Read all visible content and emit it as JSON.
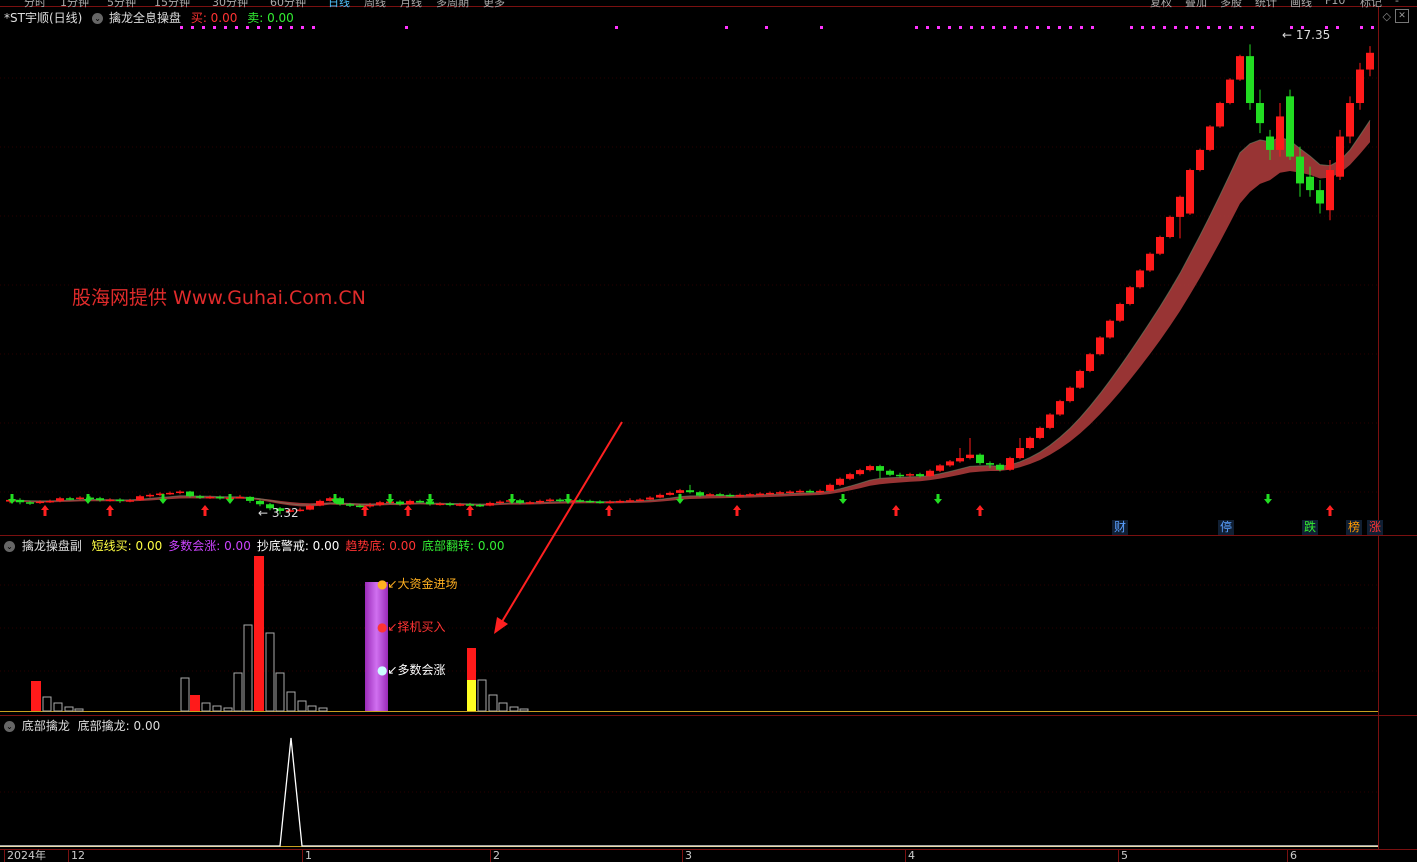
{
  "top_tabs": [
    "分时",
    "1分钟",
    "5分钟",
    "15分钟",
    "30分钟",
    "60分钟",
    "日线",
    "周线",
    "月线",
    "多周期",
    "更多"
  ],
  "right_tabs": [
    "复权",
    "叠加",
    "多股",
    "统计",
    "画线",
    "F10",
    "标记",
    "-"
  ],
  "main_panel": {
    "stock_name": "*ST宇顺(日线)",
    "indicator_name": "擒龙全息操盘",
    "buy_label": "买: 0.00",
    "sell_label": "卖: 0.00",
    "high_label": "17.35",
    "low_label": "3.32"
  },
  "watermark": "股海网提供 Www.Guhai.Com.CN",
  "event_badges": [
    {
      "text": "财",
      "color": "#5aa0ff"
    },
    {
      "text": "停",
      "color": "#5aa0ff"
    },
    {
      "text": "跌",
      "color": "#33ee33"
    },
    {
      "text": "榜",
      "color": "#ff9900"
    },
    {
      "text": "涨",
      "color": "#ff3333"
    }
  ],
  "sub_panel1": {
    "title": "擒龙操盘副",
    "items": [
      {
        "label": "短线买: ",
        "value": "0.00",
        "color": "#ffff44"
      },
      {
        "label": "多数会涨: ",
        "value": "0.00",
        "color": "#cc44ff"
      },
      {
        "label": "抄底警戒: ",
        "value": "0.00",
        "color": "#ffffff"
      },
      {
        "label": "趋势底: ",
        "value": "0.00",
        "color": "#ff3333"
      },
      {
        "label": "底部翻转: ",
        "value": "0.00",
        "color": "#33ee33"
      }
    ],
    "annotations": [
      "大资金进场",
      "择机买入",
      "多数会涨"
    ]
  },
  "sub_panel2": {
    "title": "底部擒龙",
    "value_label": "底部擒龙: 0.00"
  },
  "x_axis": {
    "labels": [
      "2024年",
      "12",
      "1",
      "2",
      "3",
      "4",
      "5",
      "6"
    ]
  },
  "colors": {
    "up": "#ff1a1a",
    "down": "#22dd22",
    "ma_band": "#a83a3a",
    "magenta": "#ff33ff"
  },
  "chart_data": {
    "type": "candlestick",
    "candles": [
      [
        3.7,
        3.75,
        3.78,
        3.65
      ],
      [
        3.75,
        3.68,
        3.8,
        3.62
      ],
      [
        3.68,
        3.66,
        3.72,
        3.6
      ],
      [
        3.66,
        3.7,
        3.74,
        3.63
      ],
      [
        3.7,
        3.72,
        3.76,
        3.66
      ],
      [
        3.72,
        3.8,
        3.84,
        3.68
      ],
      [
        3.8,
        3.78,
        3.84,
        3.74
      ],
      [
        3.78,
        3.82,
        3.86,
        3.74
      ],
      [
        3.82,
        3.8,
        3.86,
        3.76
      ],
      [
        3.8,
        3.74,
        3.84,
        3.7
      ],
      [
        3.74,
        3.76,
        3.8,
        3.7
      ],
      [
        3.76,
        3.72,
        3.8,
        3.66
      ],
      [
        3.72,
        3.74,
        3.78,
        3.68
      ],
      [
        3.74,
        3.86,
        3.9,
        3.72
      ],
      [
        3.86,
        3.9,
        3.94,
        3.82
      ],
      [
        3.9,
        3.94,
        3.98,
        3.86
      ],
      [
        3.94,
        3.96,
        4.0,
        3.9
      ],
      [
        3.96,
        4.0,
        4.04,
        3.92
      ],
      [
        4.0,
        3.86,
        4.02,
        3.82
      ],
      [
        3.86,
        3.82,
        3.9,
        3.78
      ],
      [
        3.82,
        3.84,
        3.88,
        3.78
      ],
      [
        3.84,
        3.8,
        3.88,
        3.76
      ],
      [
        3.8,
        3.82,
        3.86,
        3.76
      ],
      [
        3.82,
        3.84,
        3.9,
        3.8
      ],
      [
        3.84,
        3.72,
        3.86,
        3.66
      ],
      [
        3.72,
        3.62,
        3.76,
        3.56
      ],
      [
        3.62,
        3.5,
        3.66,
        3.44
      ],
      [
        3.5,
        3.42,
        3.54,
        3.32
      ],
      [
        3.42,
        3.44,
        3.5,
        3.38
      ],
      [
        3.44,
        3.46,
        3.52,
        3.4
      ],
      [
        3.46,
        3.58,
        3.62,
        3.44
      ],
      [
        3.58,
        3.72,
        3.76,
        3.56
      ],
      [
        3.72,
        3.8,
        3.84,
        3.7
      ],
      [
        3.8,
        3.62,
        3.84,
        3.58
      ],
      [
        3.62,
        3.58,
        3.66,
        3.54
      ],
      [
        3.58,
        3.56,
        3.62,
        3.52
      ],
      [
        3.56,
        3.6,
        3.66,
        3.52
      ],
      [
        3.6,
        3.68,
        3.72,
        3.56
      ],
      [
        3.68,
        3.7,
        3.74,
        3.64
      ],
      [
        3.7,
        3.62,
        3.74,
        3.58
      ],
      [
        3.62,
        3.72,
        3.76,
        3.6
      ],
      [
        3.72,
        3.7,
        3.76,
        3.66
      ],
      [
        3.7,
        3.62,
        3.74,
        3.58
      ],
      [
        3.62,
        3.64,
        3.68,
        3.58
      ],
      [
        3.64,
        3.6,
        3.68,
        3.56
      ],
      [
        3.6,
        3.62,
        3.66,
        3.56
      ],
      [
        3.62,
        3.6,
        3.66,
        3.56
      ],
      [
        3.6,
        3.58,
        3.64,
        3.54
      ],
      [
        3.58,
        3.66,
        3.7,
        3.56
      ],
      [
        3.66,
        3.7,
        3.74,
        3.62
      ],
      [
        3.7,
        3.74,
        3.78,
        3.66
      ],
      [
        3.74,
        3.66,
        3.78,
        3.62
      ],
      [
        3.66,
        3.68,
        3.72,
        3.62
      ],
      [
        3.68,
        3.72,
        3.76,
        3.64
      ],
      [
        3.72,
        3.76,
        3.8,
        3.68
      ],
      [
        3.76,
        3.72,
        3.8,
        3.68
      ],
      [
        3.72,
        3.74,
        3.78,
        3.7
      ],
      [
        3.74,
        3.72,
        3.78,
        3.68
      ],
      [
        3.72,
        3.7,
        3.76,
        3.66
      ],
      [
        3.7,
        3.68,
        3.74,
        3.64
      ],
      [
        3.68,
        3.7,
        3.74,
        3.64
      ],
      [
        3.7,
        3.72,
        3.76,
        3.66
      ],
      [
        3.72,
        3.74,
        3.8,
        3.7
      ],
      [
        3.74,
        3.76,
        3.8,
        3.72
      ],
      [
        3.76,
        3.82,
        3.86,
        3.74
      ],
      [
        3.82,
        3.9,
        3.94,
        3.8
      ],
      [
        3.9,
        3.96,
        4.0,
        3.88
      ],
      [
        3.96,
        4.04,
        4.08,
        3.94
      ],
      [
        4.04,
        3.98,
        4.2,
        3.94
      ],
      [
        3.98,
        3.88,
        4.02,
        3.84
      ],
      [
        3.88,
        3.92,
        3.96,
        3.86
      ],
      [
        3.92,
        3.9,
        3.96,
        3.86
      ],
      [
        3.9,
        3.88,
        3.94,
        3.84
      ],
      [
        3.88,
        3.9,
        3.94,
        3.84
      ],
      [
        3.9,
        3.92,
        3.96,
        3.86
      ],
      [
        3.92,
        3.94,
        3.98,
        3.88
      ],
      [
        3.94,
        3.96,
        4.0,
        3.9
      ],
      [
        3.96,
        3.98,
        4.02,
        3.92
      ],
      [
        3.98,
        4.0,
        4.04,
        3.94
      ],
      [
        4.0,
        4.02,
        4.06,
        3.96
      ],
      [
        4.02,
        4.0,
        4.06,
        3.96
      ],
      [
        4.0,
        4.02,
        4.06,
        3.96
      ],
      [
        4.02,
        4.2,
        4.24,
        4.0
      ],
      [
        4.2,
        4.38,
        4.42,
        4.16
      ],
      [
        4.38,
        4.52,
        4.56,
        4.34
      ],
      [
        4.52,
        4.64,
        4.68,
        4.48
      ],
      [
        4.64,
        4.76,
        4.8,
        4.6
      ],
      [
        4.76,
        4.62,
        4.8,
        4.4
      ],
      [
        4.62,
        4.5,
        4.66,
        4.46
      ],
      [
        4.5,
        4.48,
        4.56,
        4.42
      ],
      [
        4.48,
        4.52,
        4.56,
        4.44
      ],
      [
        4.52,
        4.46,
        4.56,
        4.42
      ],
      [
        4.46,
        4.62,
        4.66,
        4.44
      ],
      [
        4.62,
        4.78,
        4.82,
        4.58
      ],
      [
        4.78,
        4.9,
        4.94,
        4.74
      ],
      [
        4.9,
        5.0,
        5.3,
        4.86
      ],
      [
        5.0,
        5.1,
        5.6,
        4.96
      ],
      [
        5.1,
        4.85,
        5.14,
        4.8
      ],
      [
        4.85,
        4.8,
        4.9,
        4.7
      ],
      [
        4.8,
        4.65,
        4.85,
        4.6
      ],
      [
        4.65,
        5.0,
        5.04,
        4.62
      ],
      [
        5.0,
        5.3,
        5.6,
        4.96
      ],
      [
        5.3,
        5.6,
        5.64,
        5.26
      ],
      [
        5.6,
        5.9,
        5.94,
        5.56
      ],
      [
        5.9,
        6.3,
        6.34,
        5.86
      ],
      [
        6.3,
        6.7,
        6.74,
        6.26
      ],
      [
        6.7,
        7.1,
        7.14,
        6.66
      ],
      [
        7.1,
        7.6,
        7.64,
        7.06
      ],
      [
        7.6,
        8.1,
        8.14,
        7.56
      ],
      [
        8.1,
        8.6,
        8.64,
        8.06
      ],
      [
        8.6,
        9.1,
        9.14,
        8.56
      ],
      [
        9.1,
        9.6,
        9.64,
        9.06
      ],
      [
        9.6,
        10.1,
        10.14,
        9.56
      ],
      [
        10.1,
        10.6,
        10.64,
        10.06
      ],
      [
        10.6,
        11.1,
        11.14,
        10.56
      ],
      [
        11.1,
        11.6,
        11.64,
        11.06
      ],
      [
        11.6,
        12.2,
        12.24,
        11.56
      ],
      [
        12.2,
        12.8,
        12.84,
        11.56
      ],
      [
        12.3,
        13.6,
        13.64,
        12.26
      ],
      [
        13.6,
        14.2,
        14.24,
        13.56
      ],
      [
        14.2,
        14.9,
        14.94,
        14.16
      ],
      [
        14.9,
        15.6,
        15.64,
        14.86
      ],
      [
        15.6,
        16.3,
        16.34,
        15.56
      ],
      [
        16.3,
        17.0,
        17.04,
        16.26
      ],
      [
        17.0,
        15.6,
        17.35,
        15.4
      ],
      [
        15.6,
        15.0,
        16.0,
        14.7
      ],
      [
        14.6,
        14.2,
        14.8,
        13.9
      ],
      [
        14.2,
        15.2,
        15.6,
        14.0
      ],
      [
        15.8,
        14.0,
        16.0,
        13.9
      ],
      [
        14.0,
        13.2,
        14.3,
        12.8
      ],
      [
        13.4,
        13.0,
        13.7,
        12.8
      ],
      [
        13.0,
        12.6,
        13.3,
        12.3
      ],
      [
        12.4,
        13.6,
        13.9,
        12.1
      ],
      [
        13.4,
        14.6,
        14.8,
        13.3
      ],
      [
        14.6,
        15.6,
        15.8,
        14.4
      ],
      [
        15.6,
        16.6,
        16.8,
        15.4
      ],
      [
        16.6,
        17.1,
        17.3,
        16.4
      ]
    ],
    "ylim": [
      3.15,
      17.9
    ],
    "sub1_bars": [
      {
        "x": 36,
        "h": 30,
        "c": "#ff1a1a"
      },
      {
        "x": 47,
        "h": 14,
        "c": "out"
      },
      {
        "x": 58,
        "h": 8,
        "c": "out"
      },
      {
        "x": 69,
        "h": 4,
        "c": "out"
      },
      {
        "x": 79,
        "h": 2,
        "c": "out"
      },
      {
        "x": 185,
        "h": 33,
        "c": "out"
      },
      {
        "x": 195,
        "h": 16,
        "c": "#ff1a1a"
      },
      {
        "x": 206,
        "h": 8,
        "c": "out"
      },
      {
        "x": 217,
        "h": 5,
        "c": "out"
      },
      {
        "x": 228,
        "h": 3,
        "c": "out"
      },
      {
        "x": 238,
        "h": 38,
        "c": "out"
      },
      {
        "x": 248,
        "h": 86,
        "c": "out"
      },
      {
        "x": 259,
        "h": 155,
        "c": "#ff1a1a"
      },
      {
        "x": 270,
        "h": 78,
        "c": "out"
      },
      {
        "x": 280,
        "h": 38,
        "c": "out"
      },
      {
        "x": 291,
        "h": 19,
        "c": "out"
      },
      {
        "x": 302,
        "h": 10,
        "c": "out"
      },
      {
        "x": 312,
        "h": 5,
        "c": "out"
      },
      {
        "x": 323,
        "h": 3,
        "c": "out"
      },
      {
        "x": 482,
        "h": 31,
        "c": "out"
      },
      {
        "x": 493,
        "h": 16,
        "c": "out"
      },
      {
        "x": 503,
        "h": 8,
        "c": "out"
      },
      {
        "x": 514,
        "h": 4,
        "c": "out"
      },
      {
        "x": 524,
        "h": 2,
        "c": "out"
      }
    ],
    "sub2_spike": {
      "x": 291,
      "peak": 1.0
    }
  }
}
